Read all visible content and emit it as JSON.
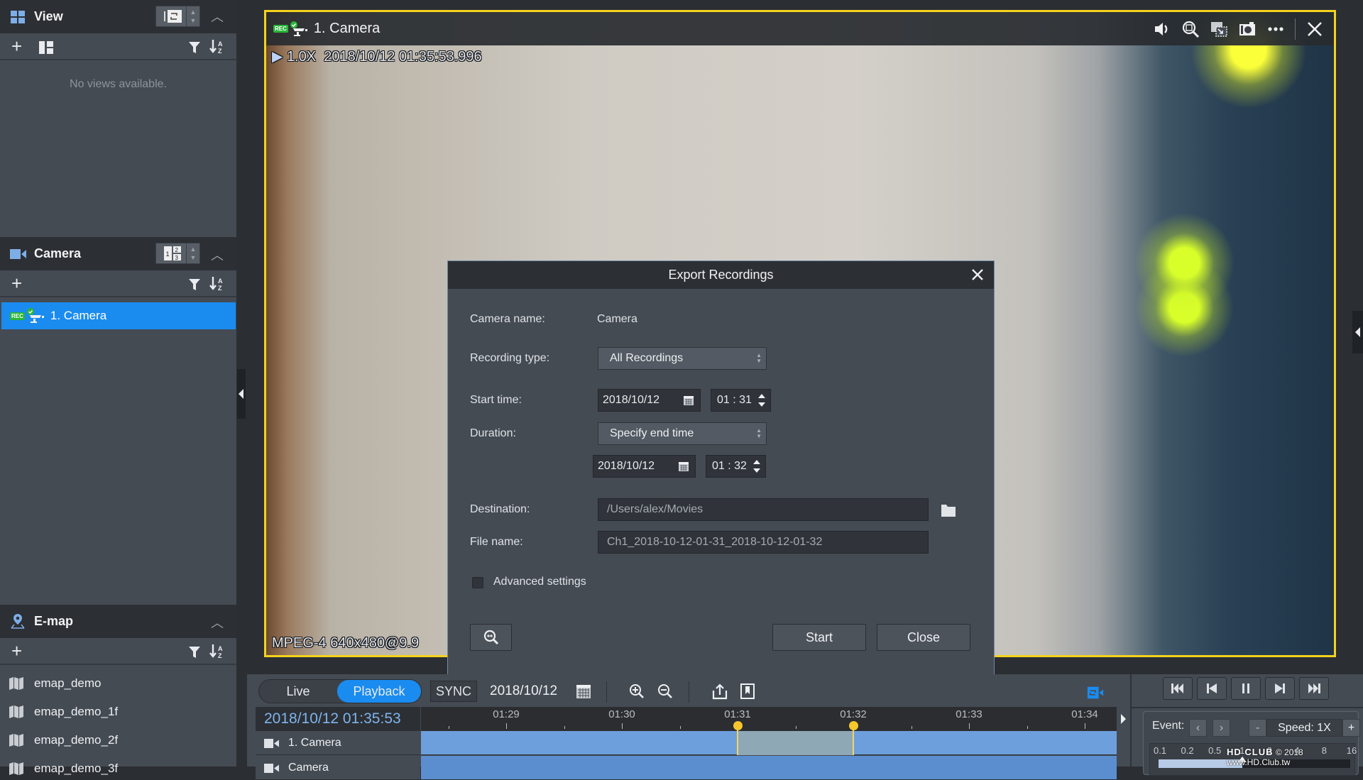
{
  "sidebar": {
    "view": {
      "title": "View",
      "empty_message": "No views available."
    },
    "camera": {
      "title": "Camera",
      "layout_digits": [
        "1",
        "2",
        "3"
      ],
      "items": [
        {
          "label": "1. Camera",
          "badge": "REC",
          "selected": true
        }
      ]
    },
    "emap": {
      "title": "E-map",
      "items": [
        {
          "label": "emap_demo"
        },
        {
          "label": "emap_demo_1f"
        },
        {
          "label": "emap_demo_2f"
        },
        {
          "label": "emap_demo_3f"
        }
      ]
    }
  },
  "video": {
    "badge": "REC",
    "title": "1. Camera",
    "osd_speed": "1.0X",
    "osd_timestamp": "2018/10/12 01:35:53.996",
    "osd_codec": "MPEG-4 640x480@9.9",
    "toolbar_icons": [
      "speaker-icon",
      "digital-zoom-icon",
      "pip-icon",
      "snapshot-icon",
      "more-icon",
      "close-icon"
    ]
  },
  "dialog": {
    "title": "Export Recordings",
    "camera_name_label": "Camera name:",
    "camera_name_value": "Camera",
    "recording_type_label": "Recording type:",
    "recording_type_value": "All Recordings",
    "start_time_label": "Start time:",
    "start_date": "2018/10/12",
    "start_time": "01 : 31",
    "duration_label": "Duration:",
    "duration_value": "Specify end time",
    "end_date": "2018/10/12",
    "end_time": "01 : 32",
    "destination_label": "Destination:",
    "destination_value": "/Users/alex/Movies",
    "file_name_label": "File name:",
    "file_name_value": "Ch1_2018-10-12-01-31_2018-10-12-01-32",
    "advanced_label": "Advanced settings",
    "advanced_checked": false,
    "start_button": "Start",
    "close_button": "Close"
  },
  "bottom": {
    "mode_live": "Live",
    "mode_playback": "Playback",
    "active_mode": "Playback",
    "sync_label": "SYNC",
    "date": "2018/10/12",
    "current_time": "2018/10/12 01:35:53",
    "ruler_labels": [
      "01:29",
      "01:30",
      "01:31",
      "01:32",
      "01:33",
      "01:34"
    ],
    "tracks": [
      {
        "label": "1. Camera"
      },
      {
        "label": "Camera"
      }
    ],
    "selection_start": "01:31",
    "selection_end": "01:32"
  },
  "controls": {
    "event_label": "Event:",
    "speed_minus": "-",
    "speed_label": "Speed: 1X",
    "speed_plus": "+",
    "speed_scale": [
      "0.1",
      "0.2",
      "0.5",
      "1",
      "2",
      "4",
      "8",
      "16"
    ],
    "speed_value": 1
  },
  "watermark": {
    "text": "© 2018 www.HD.Club.tw",
    "logo": "HD CLUB"
  },
  "colors": {
    "accent": "#1a8cf0",
    "active_tile_border": "#f4d21d",
    "rec_badge": "#2ab53a",
    "timeline_track": "#6d9fdc",
    "marker": "#f5c72c"
  }
}
